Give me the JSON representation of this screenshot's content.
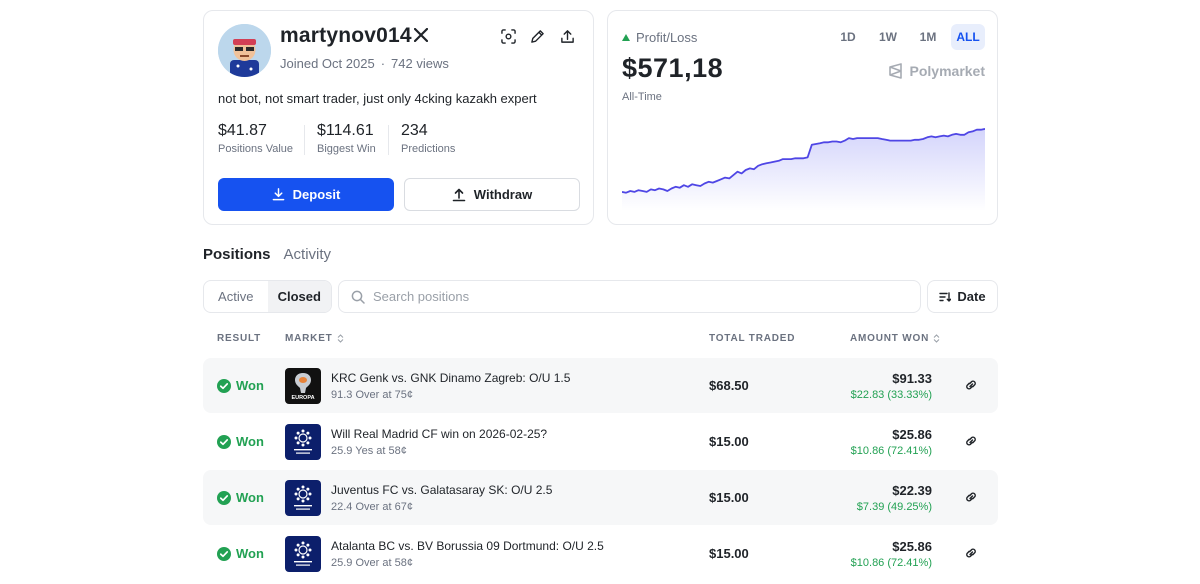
{
  "profile": {
    "username": "martynov014",
    "joined": "Joined Oct 2025",
    "separator": "·",
    "views": "742 views",
    "bio": "not bot, not smart trader, just only 4cking kazakh expert",
    "stats": [
      {
        "value": "$41.87",
        "label": "Positions Value"
      },
      {
        "value": "$114.61",
        "label": "Biggest Win"
      },
      {
        "value": "234",
        "label": "Predictions"
      }
    ],
    "deposit_label": "Deposit",
    "withdraw_label": "Withdraw"
  },
  "pnl": {
    "label": "Profit/Loss",
    "value": "$571,18",
    "period_label": "All-Time",
    "brand": "Polymarket",
    "ranges": [
      "1D",
      "1W",
      "1M",
      "ALL"
    ],
    "active_range": "ALL",
    "series": [
      0.18,
      0.17,
      0.19,
      0.18,
      0.2,
      0.19,
      0.18,
      0.21,
      0.2,
      0.22,
      0.21,
      0.19,
      0.22,
      0.24,
      0.23,
      0.26,
      0.24,
      0.27,
      0.26,
      0.25,
      0.28,
      0.3,
      0.29,
      0.31,
      0.33,
      0.35,
      0.34,
      0.38,
      0.42,
      0.4,
      0.44,
      0.46,
      0.45,
      0.49,
      0.51,
      0.52,
      0.53,
      0.54,
      0.55,
      0.57,
      0.57,
      0.57,
      0.58,
      0.58,
      0.58,
      0.59,
      0.74,
      0.75,
      0.76,
      0.77,
      0.77,
      0.78,
      0.78,
      0.77,
      0.79,
      0.82,
      0.81,
      0.82,
      0.82,
      0.82,
      0.82,
      0.82,
      0.82,
      0.81,
      0.8,
      0.79,
      0.79,
      0.79,
      0.79,
      0.79,
      0.79,
      0.8,
      0.8,
      0.81,
      0.83,
      0.84,
      0.83,
      0.84,
      0.85,
      0.84,
      0.86,
      0.87,
      0.86,
      0.86,
      0.89,
      0.9,
      0.92,
      0.92,
      0.93
    ],
    "line_color": "#4f46e5"
  },
  "tabs": {
    "positions": "Positions",
    "activity": "Activity",
    "active": "positions"
  },
  "filter": {
    "segments": [
      "Active",
      "Closed"
    ],
    "active_segment": "Closed",
    "search_placeholder": "Search positions",
    "sort_label": "Date"
  },
  "table": {
    "headers": {
      "result": "RESULT",
      "market": "MARKET",
      "total_traded": "TOTAL TRADED",
      "amount_won": "AMOUNT WON"
    },
    "rows": [
      {
        "result": "Won",
        "league": "europa",
        "title": "KRC Genk vs. GNK Dinamo Zagreb: O/U 1.5",
        "subtitle": "91.3 Over at 75¢",
        "traded": "$68.50",
        "won": "$91.33",
        "pnl": "$22.83 (33.33%)"
      },
      {
        "result": "Won",
        "league": "champions",
        "title": "Will Real Madrid CF win on 2026-02-25?",
        "subtitle": "25.9 Yes at 58¢",
        "traded": "$15.00",
        "won": "$25.86",
        "pnl": "$10.86 (72.41%)"
      },
      {
        "result": "Won",
        "league": "champions",
        "title": "Juventus FC vs. Galatasaray SK: O/U 2.5",
        "subtitle": "22.4 Over at 67¢",
        "traded": "$15.00",
        "won": "$22.39",
        "pnl": "$7.39 (49.25%)"
      },
      {
        "result": "Won",
        "league": "champions",
        "title": "Atalanta BC vs. BV Borussia 09 Dortmund: O/U 2.5",
        "subtitle": "25.9 Over at 58¢",
        "traded": "$15.00",
        "won": "$25.86",
        "pnl": "$10.86 (72.41%)"
      }
    ]
  },
  "colors": {
    "accent": "#1652f0",
    "positive": "#22a153",
    "muted": "#6b7280"
  },
  "icons": [
    "x-logo-icon",
    "scan-icon",
    "pencil-icon",
    "share-icon",
    "download-icon",
    "upload-icon",
    "triangle-up-icon",
    "polymarket-logo-icon",
    "search-icon",
    "sort-icon",
    "check-circle-icon",
    "link-icon",
    "sort-arrows-icon"
  ]
}
